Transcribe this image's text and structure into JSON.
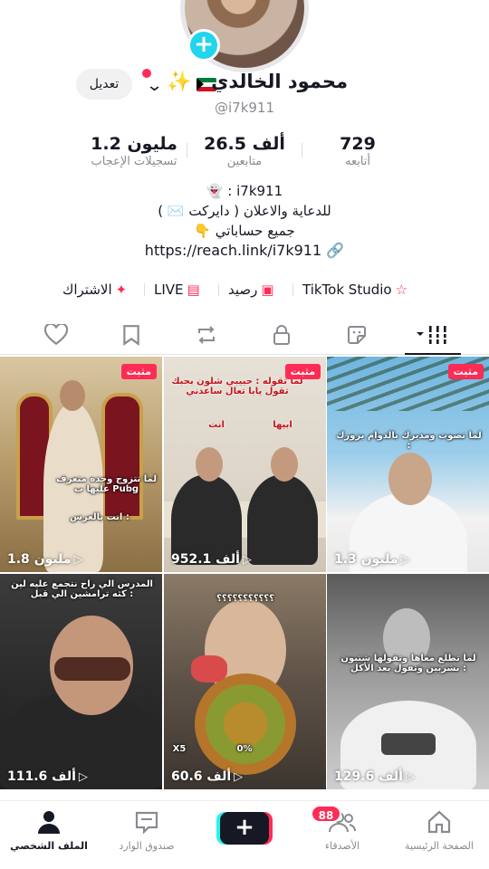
{
  "profile": {
    "edit_label": "تعديل",
    "display_name": "محمود الخالدي",
    "handle": "@i7k911",
    "add_icon": "plus-icon"
  },
  "stats": {
    "likes_value": "1.2 مليون",
    "likes_label": "تسجيلات الإعجاب",
    "followers_value": "26.5 ألف",
    "followers_label": "متابعين",
    "following_value": "729",
    "following_label": "أتابعه"
  },
  "bio": {
    "snap": "👻 : i7k911",
    "ads": "للدعاية والاعلان ( دايركت ✉️ )",
    "accounts": "جميع حساباتي 👇",
    "link": "https://reach.link/i7k911"
  },
  "quick_links": {
    "studio": "TikTok Studio",
    "balance": "رصيد",
    "live": "LIVE",
    "subscribe": "الاشتراك"
  },
  "tabs": [
    "liked",
    "saved",
    "reposts",
    "private",
    "stickers",
    "videos"
  ],
  "grid": {
    "pinned_label": "مثبت",
    "videos": [
      {
        "views": "1.3 مليون",
        "caption": "لما تصوت ومديرك بالدوام يزورك :"
      },
      {
        "views": "952.1 ألف",
        "caption": "لما تقوله : حبيبي شلون بحبك تقول يابا تعال ساعدني",
        "tag1": "انت",
        "tag2": "ابيها"
      },
      {
        "views": "1.8 مليون",
        "caption": "لما تتزوج وحده متعرف عليها ب Pubg",
        "caption2": "انت بالعرس :"
      },
      {
        "views": "129.6 ألف",
        "caption": "لما تطلع معاها وتقولها شتبون تشربين وتقول بعد الأكل :"
      },
      {
        "views": "60.6 ألف",
        "caption": "؟؟؟؟؟؟؟؟؟؟؟",
        "caption2": "0%",
        "caption3": "X5"
      },
      {
        "views": "111.6 ألف",
        "caption": "المدرس الي راح نتجمع عليه لين كثه ترامشين الي قبل :"
      }
    ]
  },
  "nav": {
    "home": "الصفحة الرئيسية",
    "friends": "الأصدقاء",
    "friends_badge": "88",
    "inbox": "صندوق الوارد",
    "profile": "الملف الشخصي"
  },
  "colors": {
    "accent": "#fe2c55",
    "cyan": "#20d5ec",
    "text": "#161823",
    "muted": "#8a8b91"
  }
}
